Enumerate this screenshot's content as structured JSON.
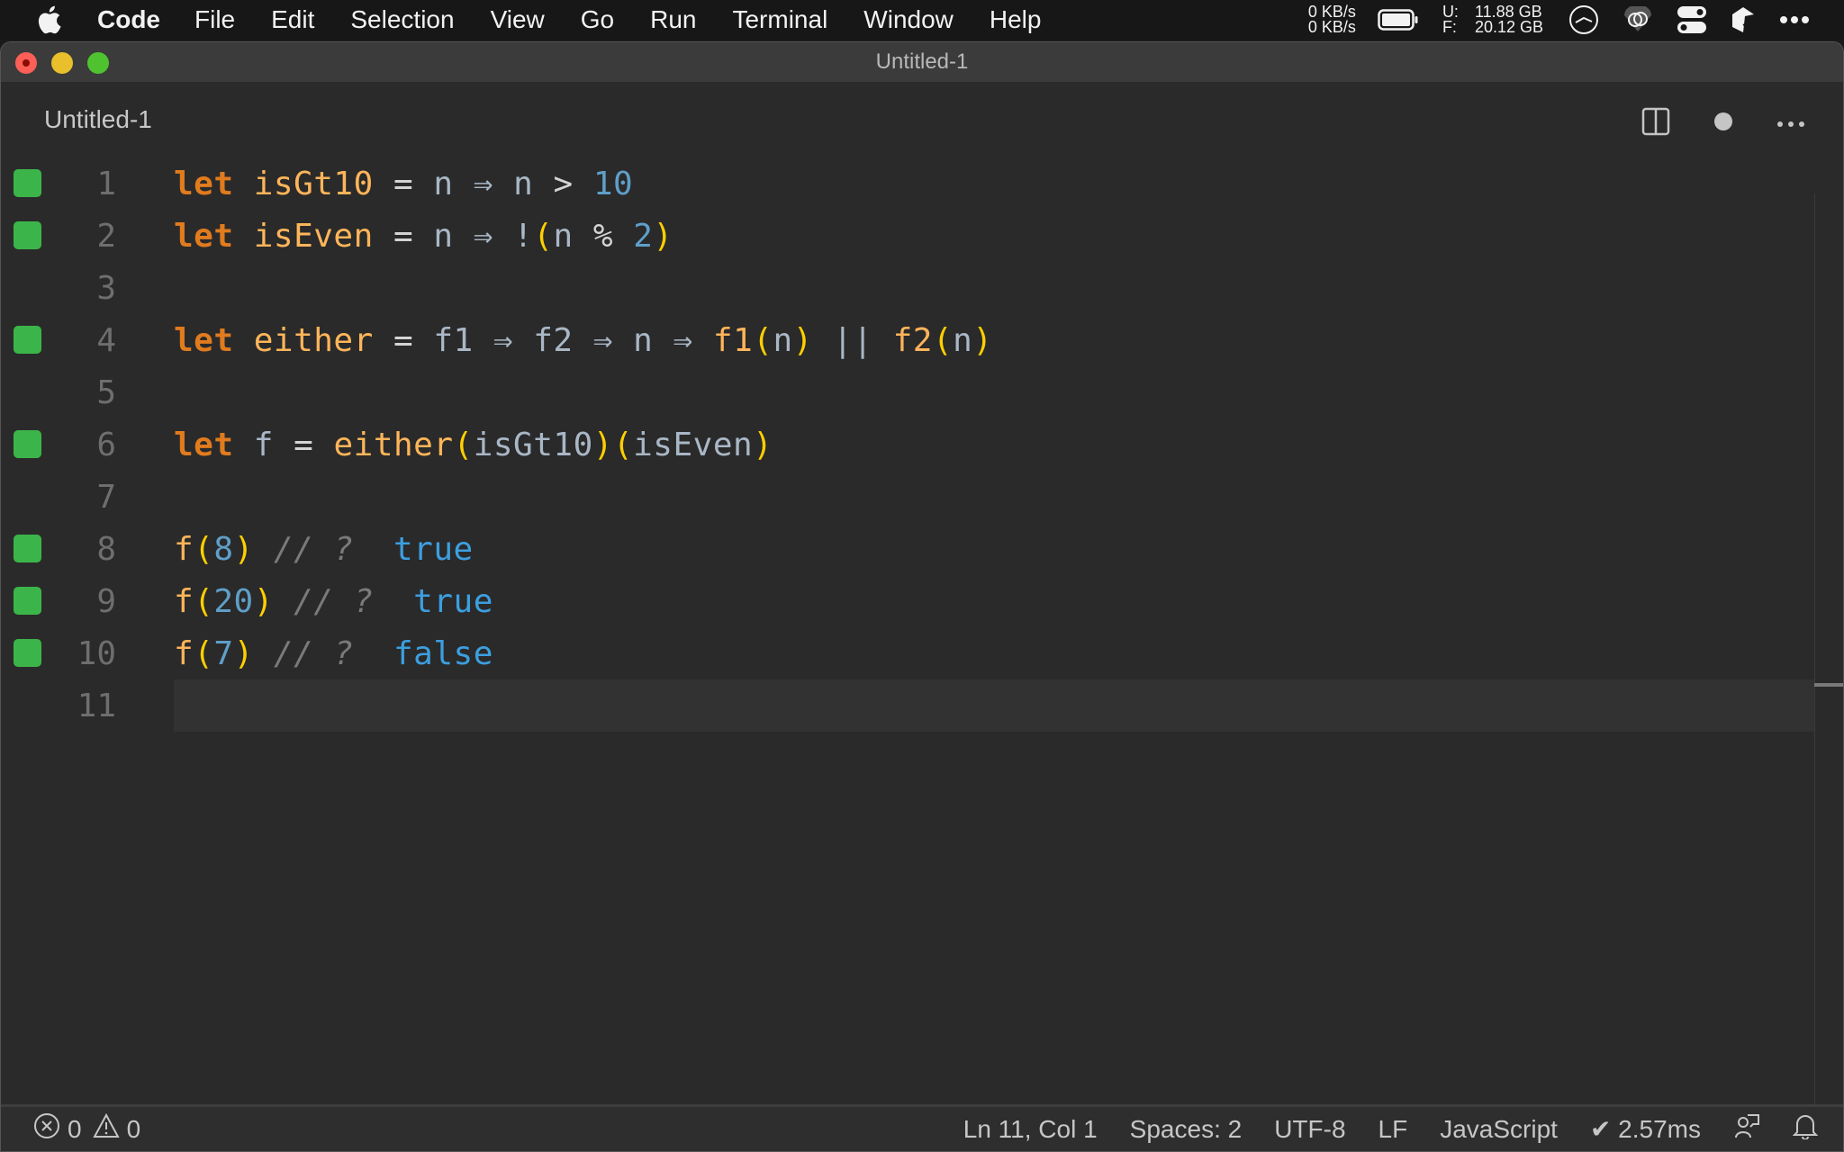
{
  "menubar": {
    "app_name": "Code",
    "items": [
      "File",
      "Edit",
      "Selection",
      "View",
      "Go",
      "Run",
      "Terminal",
      "Window",
      "Help"
    ],
    "network": {
      "up": "0 KB/s",
      "down": "0 KB/s"
    },
    "memory": {
      "used_label": "U:",
      "used": "11.88 GB",
      "free_label": "F:",
      "free": "20.12 GB"
    },
    "tray_icons": [
      "battery-icon",
      "activity-monitor-icon",
      "creative-cloud-icon",
      "control-center-icon",
      "app-tray-icon",
      "more-icon"
    ]
  },
  "window": {
    "title": "Untitled-1",
    "traffic_lights": [
      "close",
      "minimize",
      "maximize"
    ]
  },
  "tab": {
    "title": "Untitled-1",
    "actions": [
      "split-editor",
      "unsaved-dot",
      "more-actions"
    ]
  },
  "editor": {
    "language": "JavaScript",
    "current_line": 11,
    "lines": [
      {
        "n": "1",
        "covered": true
      },
      {
        "n": "2",
        "covered": true
      },
      {
        "n": "3",
        "covered": false
      },
      {
        "n": "4",
        "covered": true
      },
      {
        "n": "5",
        "covered": false
      },
      {
        "n": "6",
        "covered": true
      },
      {
        "n": "7",
        "covered": false
      },
      {
        "n": "8",
        "covered": true
      },
      {
        "n": "9",
        "covered": true
      },
      {
        "n": "10",
        "covered": true
      },
      {
        "n": "11",
        "covered": false
      }
    ],
    "tokens": {
      "l1": [
        "let",
        "isGt10",
        "=",
        "n",
        "⇒",
        "n",
        ">",
        "10"
      ],
      "l2": [
        "let",
        "isEven",
        "=",
        "n",
        "⇒",
        "!",
        "(",
        "n",
        "%",
        "2",
        ")"
      ],
      "l4": [
        "let",
        "either",
        "=",
        "f1",
        "⇒",
        "f2",
        "⇒",
        "n",
        "⇒",
        "f1",
        "(",
        "n",
        ")",
        "||",
        "f2",
        "(",
        "n",
        ")"
      ],
      "l6": [
        "let",
        "f",
        "=",
        "either",
        "(",
        "isGt10",
        ")",
        "(",
        "isEven",
        ")"
      ],
      "l8": [
        "f",
        "(",
        "8",
        ")",
        "// ?",
        "true"
      ],
      "l9": [
        "f",
        "(",
        "20",
        ")",
        "// ?",
        "true"
      ],
      "l10": [
        "f",
        "(",
        "7",
        ")",
        "// ?",
        "false"
      ]
    }
  },
  "statusbar": {
    "errors": "0",
    "warnings": "0",
    "position": "Ln 11, Col 1",
    "indent": "Spaces: 2",
    "encoding": "UTF-8",
    "eol": "LF",
    "language": "JavaScript",
    "timing": "✔ 2.57ms"
  },
  "colors": {
    "keyword": "#e07b1e",
    "function": "#ffb55a",
    "identifier": "#a9b7c6",
    "number": "#5f9fc9",
    "bracket": "#ffcf00",
    "comment": "#7a7a7a",
    "result": "#3c9fe0",
    "coverage": "#3bb54a"
  }
}
